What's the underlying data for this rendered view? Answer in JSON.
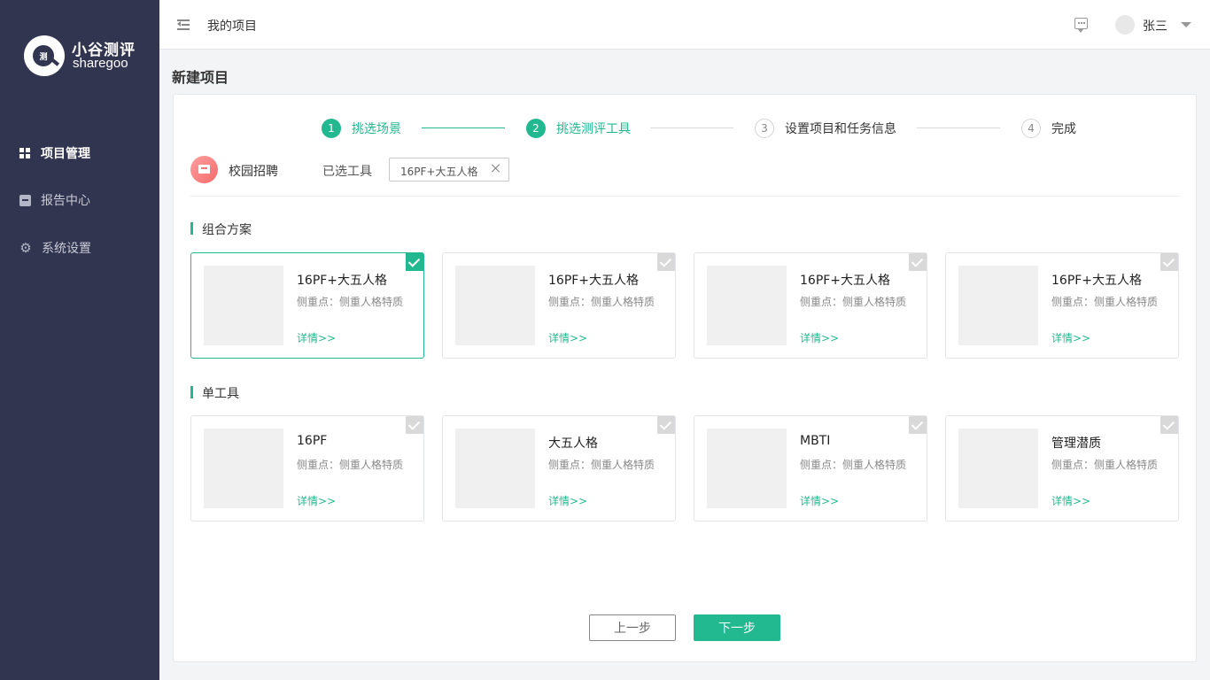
{
  "brand": {
    "name_cn": "小谷测评",
    "name_en": "sharegoo",
    "mark": "测"
  },
  "sidebar": {
    "items": [
      {
        "label": "项目管理",
        "icon": "grid-icon",
        "active": true
      },
      {
        "label": "报告中心",
        "icon": "report-icon",
        "active": false
      },
      {
        "label": "系统设置",
        "icon": "gear-icon",
        "active": false
      }
    ]
  },
  "header": {
    "title": "我的项目",
    "user": "张三"
  },
  "page": {
    "title": "新建项目"
  },
  "steps": [
    {
      "num": "1",
      "label": "挑选场景",
      "status": "done"
    },
    {
      "num": "2",
      "label": "挑选测评工具",
      "status": "done"
    },
    {
      "num": "3",
      "label": "设置项目和任务信息",
      "status": "todo"
    },
    {
      "num": "4",
      "label": "完成",
      "status": "todo"
    }
  ],
  "scene": {
    "label": "校园招聘",
    "selected_label": "已选工具",
    "selected_tag": "16PF+大五人格"
  },
  "sections": {
    "combo": {
      "title": "组合方案",
      "tools": [
        {
          "name": "16PF+大五人格",
          "desc": "侧重点：侧重人格特质",
          "link": "详情>>",
          "selected": true
        },
        {
          "name": "16PF+大五人格",
          "desc": "侧重点：侧重人格特质",
          "link": "详情>>",
          "selected": false
        },
        {
          "name": "16PF+大五人格",
          "desc": "侧重点：侧重人格特质",
          "link": "详情>>",
          "selected": false
        },
        {
          "name": "16PF+大五人格",
          "desc": "侧重点：侧重人格特质",
          "link": "详情>>",
          "selected": false
        }
      ]
    },
    "single": {
      "title": "单工具",
      "tools": [
        {
          "name": "16PF",
          "desc": "侧重点：侧重人格特质",
          "link": "详情>>",
          "selected": false
        },
        {
          "name": "大五人格",
          "desc": "侧重点：侧重人格特质",
          "link": "详情>>",
          "selected": false
        },
        {
          "name": "MBTI",
          "desc": "侧重点：侧重人格特质",
          "link": "详情>>",
          "selected": false
        },
        {
          "name": "管理潜质",
          "desc": "侧重点：侧重人格特质",
          "link": "详情>>",
          "selected": false
        }
      ]
    }
  },
  "buttons": {
    "prev": "上一步",
    "next": "下一步"
  },
  "colors": {
    "accent": "#22b990",
    "sidebar": "#323550"
  }
}
